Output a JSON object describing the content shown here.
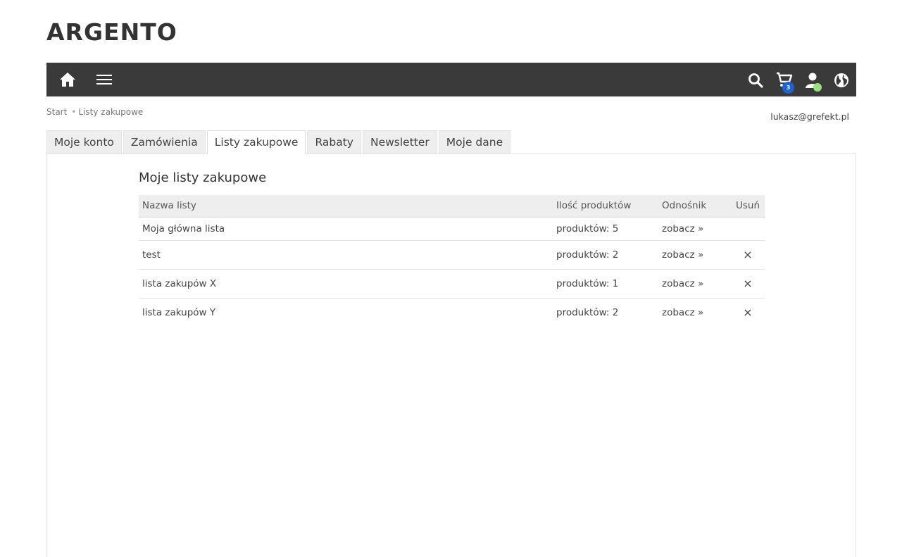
{
  "brand": {
    "logo": "ARGENTO"
  },
  "navbar": {
    "icons": [
      "home-icon",
      "menu-icon",
      "search-icon",
      "cart-icon",
      "user-icon",
      "globe-icon"
    ],
    "cart_count": "3",
    "colors": {
      "bar": "#3a3a3a",
      "cart_badge": "#1e63d6",
      "user_status": "#9be07a"
    }
  },
  "breadcrumb": {
    "home": "Start",
    "current": "Listy zakupowe"
  },
  "user": {
    "email": "lukasz@grefekt.pl"
  },
  "tabs": [
    {
      "label": "Moje konto"
    },
    {
      "label": "Zamówienia"
    },
    {
      "label": "Listy zakupowe"
    },
    {
      "label": "Rabaty"
    },
    {
      "label": "Newsletter"
    },
    {
      "label": "Moje dane"
    }
  ],
  "active_tab": "Listy zakupowe",
  "main": {
    "title": "Moje listy zakupowe",
    "table": {
      "headers": {
        "name": "Nazwa listy",
        "count": "Ilość produktów",
        "link": "Odnośnik",
        "delete": "Usuń"
      },
      "rows": [
        {
          "name": "Moja główna lista",
          "count": "produktów: 5",
          "link": "zobacz »",
          "delete": ""
        },
        {
          "name": "test",
          "count": "produktów: 2",
          "link": "zobacz »",
          "delete": "×"
        },
        {
          "name": "lista zakupów X",
          "count": "produktów: 1",
          "link": "zobacz »",
          "delete": "×"
        },
        {
          "name": "lista zakupów Y",
          "count": "produktów: 2",
          "link": "zobacz »",
          "delete": "×"
        }
      ]
    }
  }
}
